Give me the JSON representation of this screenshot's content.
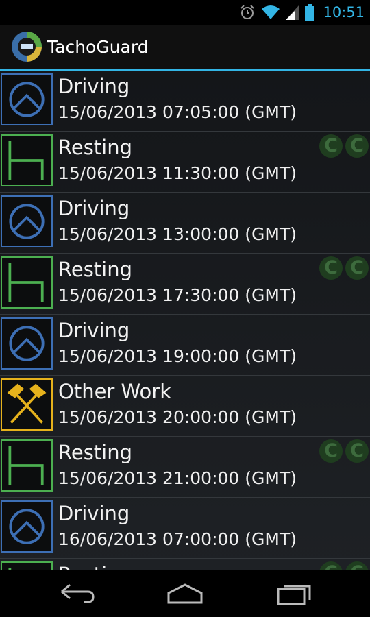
{
  "status_bar": {
    "time": "10:51",
    "icons": [
      "alarm-icon",
      "wifi-icon",
      "signal-icon",
      "battery-icon"
    ],
    "accent_color": "#33b5e5"
  },
  "app": {
    "title": "TachoGuard",
    "icon": "tachograph-app-icon"
  },
  "activity_colors": {
    "Driving": "#3d6fb5",
    "Resting": "#4caf50",
    "Other Work": "#e6b21c"
  },
  "entries": [
    {
      "type": "Driving",
      "time": "15/06/2013 07:05:00 (GMT)",
      "icon": "steering-wheel-icon",
      "badges": []
    },
    {
      "type": "Resting",
      "time": "15/06/2013 11:30:00 (GMT)",
      "icon": "bed-icon",
      "badges": [
        "C",
        "C"
      ]
    },
    {
      "type": "Driving",
      "time": "15/06/2013 13:00:00 (GMT)",
      "icon": "steering-wheel-icon",
      "badges": []
    },
    {
      "type": "Resting",
      "time": "15/06/2013 17:30:00 (GMT)",
      "icon": "bed-icon",
      "badges": [
        "C",
        "C"
      ]
    },
    {
      "type": "Driving",
      "time": "15/06/2013 19:00:00 (GMT)",
      "icon": "steering-wheel-icon",
      "badges": []
    },
    {
      "type": "Other Work",
      "time": "15/06/2013 20:00:00 (GMT)",
      "icon": "crossed-hammers-icon",
      "badges": []
    },
    {
      "type": "Resting",
      "time": "15/06/2013 21:00:00 (GMT)",
      "icon": "bed-icon",
      "badges": [
        "C",
        "C"
      ]
    },
    {
      "type": "Driving",
      "time": "16/06/2013 07:00:00 (GMT)",
      "icon": "steering-wheel-icon",
      "badges": []
    },
    {
      "type": "Resting",
      "time": "",
      "icon": "bed-icon",
      "badges": [
        "C",
        "C"
      ]
    }
  ],
  "nav_bar": {
    "buttons": [
      "back-icon",
      "home-icon",
      "recent-apps-icon"
    ]
  }
}
